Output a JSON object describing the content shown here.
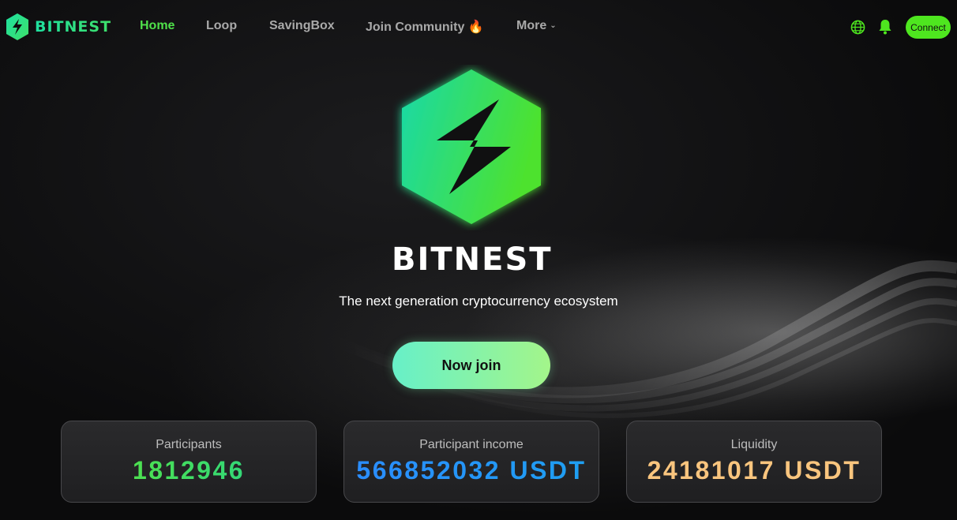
{
  "nav": {
    "brand": "BITNEST",
    "items": [
      {
        "label": "Home",
        "active": true
      },
      {
        "label": "Loop"
      },
      {
        "label": "SavingBox"
      },
      {
        "label": "Join Community 🔥"
      },
      {
        "label": "More"
      }
    ],
    "connect_label": "Connect",
    "icons": [
      "globe-icon",
      "bell-icon"
    ]
  },
  "hero": {
    "brand": "BITNEST",
    "tagline": "The next generation cryptocurrency ecosystem",
    "cta_label": "Now join"
  },
  "stats": [
    {
      "label": "Participants",
      "value": "1812946"
    },
    {
      "label": "Participant income",
      "value": "566852032 USDT"
    },
    {
      "label": "Liquidity",
      "value": "24181017 USDT"
    }
  ],
  "colors": {
    "accent": "#4ee61f",
    "active_nav": "#4fe04a",
    "participants_value": "#3fdc5e",
    "income_value": "#2b8cff",
    "liquidity_value": "#f9c57e"
  }
}
